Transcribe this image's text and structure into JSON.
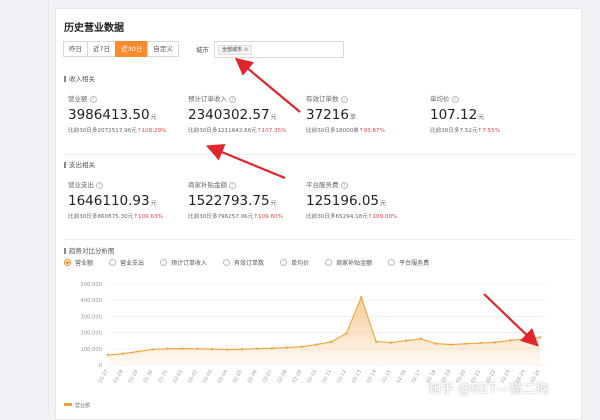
{
  "page": {
    "title": "历史营业数据"
  },
  "range_tabs": [
    {
      "label": "昨日",
      "active": false
    },
    {
      "label": "近7日",
      "active": false
    },
    {
      "label": "近30日",
      "active": true
    },
    {
      "label": "自定义",
      "active": false
    }
  ],
  "city": {
    "label": "城市",
    "tag": "全部城市",
    "tag_close": "⊗"
  },
  "income_section": {
    "title": "收入相关",
    "metrics": [
      {
        "label": "营业额",
        "value": "3986413.50",
        "unit": "元",
        "compare": "比前30日多2072517.96元",
        "change": "↑108.29%"
      },
      {
        "label": "预计订单收入",
        "value": "2340302.57",
        "unit": "元",
        "compare": "比前30日多1211642.66元",
        "change": "↑107.35%"
      },
      {
        "label": "有效订单数",
        "value": "37216",
        "unit": "单",
        "compare": "比前30日多18000单",
        "change": "↑93.67%"
      },
      {
        "label": "单均价",
        "value": "107.12",
        "unit": "元",
        "compare": "比前30日多7.52元",
        "change": "↑7.55%"
      }
    ]
  },
  "expense_section": {
    "title": "支出相关",
    "metrics": [
      {
        "label": "营业支出",
        "value": "1646110.93",
        "unit": "元",
        "compare": "比前30日多860875.30元",
        "change": "↑109.63%"
      },
      {
        "label": "商家补贴金额",
        "value": "1522793.75",
        "unit": "元",
        "compare": "比前30日多796257.06元",
        "change": "↑109.60%"
      },
      {
        "label": "平台服务费",
        "value": "125196.05",
        "unit": "元",
        "compare": "比前30日多65294.18元",
        "change": "↑109.00%"
      }
    ]
  },
  "trend_section": {
    "title": "趋势对比分析图"
  },
  "legend": [
    {
      "label": "营业额",
      "on": true
    },
    {
      "label": "营业支出",
      "on": false
    },
    {
      "label": "预计订单收入",
      "on": false
    },
    {
      "label": "有效订单数",
      "on": false
    },
    {
      "label": "单均价",
      "on": false
    },
    {
      "label": "商家补贴金额",
      "on": false
    },
    {
      "label": "平台服务费",
      "on": false
    }
  ],
  "bottom_legend": "营业额",
  "watermark": "知乎 @RET—猫二狗",
  "colors": {
    "accent": "#ff8a2b",
    "line": "#f2a23c",
    "up": "#e5484d",
    "arrow": "#e0262a"
  },
  "chart_data": {
    "type": "area",
    "x": [
      "01-27",
      "01-28",
      "01-29",
      "01-30",
      "01-31",
      "02-01",
      "02-02",
      "02-03",
      "02-04",
      "02-05",
      "02-06",
      "02-07",
      "02-08",
      "02-09",
      "02-10",
      "02-11",
      "02-12",
      "02-13",
      "02-14",
      "02-15",
      "02-16",
      "02-17",
      "02-18",
      "02-19",
      "02-20",
      "02-21",
      "02-22",
      "02-23",
      "02-24",
      "02-25"
    ],
    "series": [
      {
        "name": "营业额",
        "values": [
          62000,
          70000,
          83000,
          96000,
          100000,
          101000,
          100000,
          98000,
          95000,
          97000,
          101000,
          103000,
          108000,
          113000,
          126000,
          143000,
          195000,
          418000,
          145000,
          138000,
          150000,
          162000,
          132000,
          126000,
          131000,
          135000,
          140000,
          152000,
          162000,
          170000
        ]
      }
    ],
    "ylim": [
      0,
      500000
    ],
    "yticks": [
      "0",
      "100,000",
      "200,000",
      "300,000",
      "400,000",
      "500,000"
    ],
    "grid": true
  }
}
